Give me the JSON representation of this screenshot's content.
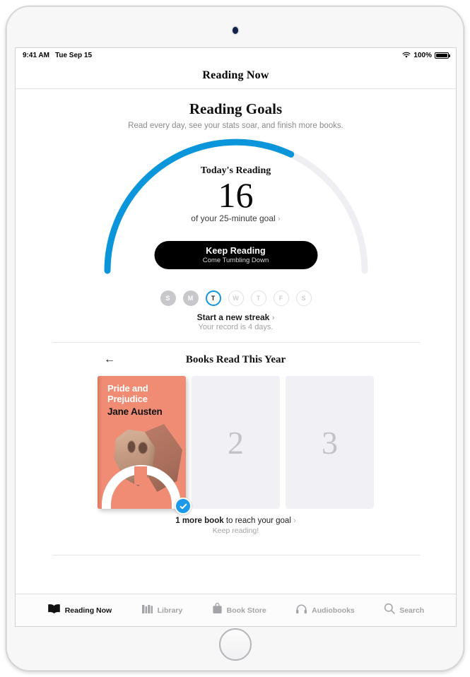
{
  "status_bar": {
    "time": "9:41 AM",
    "date": "Tue Sep 15",
    "battery_percent": "100%",
    "wifi_icon": "wifi-icon",
    "battery_icon": "battery-icon"
  },
  "nav": {
    "title": "Reading Now"
  },
  "goals": {
    "title": "Reading Goals",
    "subtitle": "Read every day, see your stats soar, and finish more books.",
    "gauge": {
      "label": "Today's Reading",
      "value": "16",
      "goal_text": "of your 25-minute goal",
      "chevron": "›",
      "minutes_read": 16,
      "minutes_goal": 25,
      "progress_percent": 64,
      "progress_color": "#0b96db",
      "track_color": "#eeeef3"
    },
    "keep_button": {
      "title": "Keep Reading",
      "subtitle": "Come Tumbling Down"
    },
    "week": [
      {
        "letter": "S",
        "state": "filled"
      },
      {
        "letter": "M",
        "state": "filled"
      },
      {
        "letter": "T",
        "state": "today"
      },
      {
        "letter": "W",
        "state": "empty"
      },
      {
        "letter": "T",
        "state": "empty"
      },
      {
        "letter": "F",
        "state": "empty"
      },
      {
        "letter": "S",
        "state": "empty"
      }
    ],
    "streak": {
      "main": "Start a new streak",
      "chevron": "›",
      "sub": "Your record is 4 days."
    }
  },
  "books_section": {
    "back_arrow": "←",
    "title": "Books Read This Year",
    "book": {
      "title_line1": "Pride and",
      "title_line2": "Prejudice",
      "author": "Jane Austen",
      "cover_color": "#f08c74",
      "completed": true,
      "badge_icon": "checkmark-icon"
    },
    "empty_slots": [
      "2",
      "3"
    ],
    "footer_bold": "1 more book",
    "footer_rest": " to reach your goal",
    "footer_chevron": "›",
    "footer_sub": "Keep reading!"
  },
  "tab_bar": {
    "tabs": [
      {
        "label": "Reading Now",
        "icon": "open-book-icon",
        "active": true
      },
      {
        "label": "Library",
        "icon": "books-shelf-icon",
        "active": false
      },
      {
        "label": "Book Store",
        "icon": "shopping-bag-icon",
        "active": false
      },
      {
        "label": "Audiobooks",
        "icon": "headphones-icon",
        "active": false
      },
      {
        "label": "Search",
        "icon": "search-icon",
        "active": false
      }
    ]
  }
}
